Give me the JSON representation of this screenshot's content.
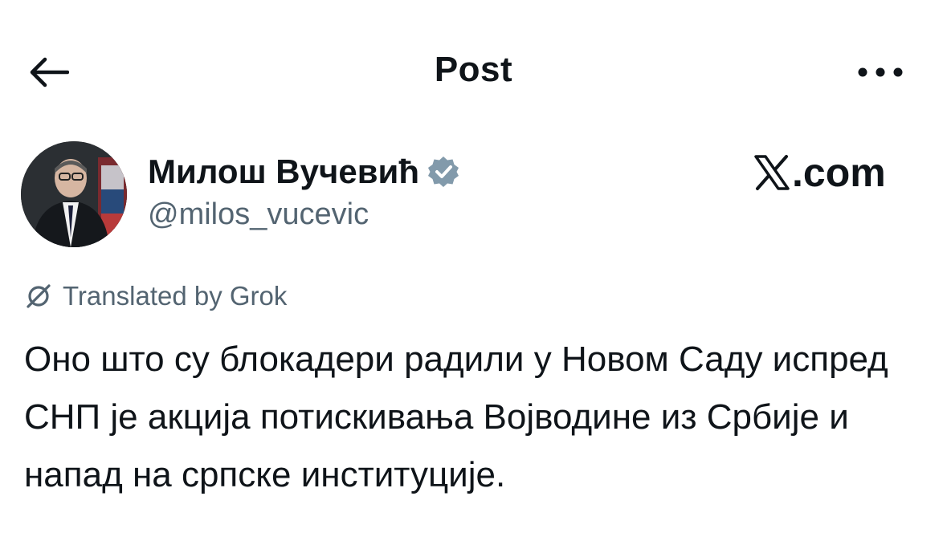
{
  "header": {
    "title": "Post",
    "back_icon": "arrow-left-icon",
    "more_icon": "ellipsis-icon"
  },
  "author": {
    "name": "Милош Вучевић",
    "handle": "@milos_vucevic",
    "verified_icon": "verified-badge-icon",
    "verified_color": "#829aab"
  },
  "site": {
    "label": ".com",
    "logo_icon": "x-logo-icon"
  },
  "translation": {
    "label": "Translated by Grok",
    "icon": "grok-icon"
  },
  "post": {
    "text": "Оно што су блокадери радили у Новом Саду испред СНП је акција потискивања Војводине из Србије и напад на српске институције."
  },
  "colors": {
    "text_primary": "#0f1419",
    "text_secondary": "#536471",
    "background": "#ffffff"
  }
}
